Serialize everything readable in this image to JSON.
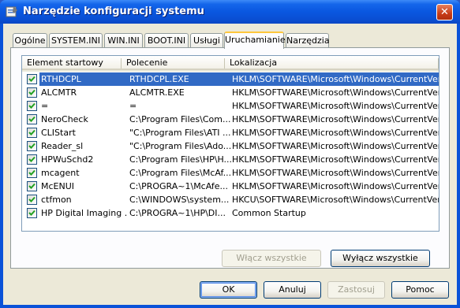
{
  "window": {
    "title": "Narzędzie konfiguracji systemu",
    "close_label": "✕"
  },
  "tabs": [
    {
      "label": "Ogólne"
    },
    {
      "label": "SYSTEM.INI"
    },
    {
      "label": "WIN.INI"
    },
    {
      "label": "BOOT.INI"
    },
    {
      "label": "Usługi"
    },
    {
      "label": "Uruchamianie"
    },
    {
      "label": "Narzędzia"
    }
  ],
  "active_tab": "Uruchamianie",
  "list": {
    "columns": [
      "Element startowy",
      "Polecenie",
      "Lokalizacja"
    ],
    "rows": [
      {
        "checked": true,
        "selected": true,
        "name": "RTHDCPL",
        "command": "RTHDCPL.EXE",
        "location": "HKLM\\SOFTWARE\\Microsoft\\Windows\\CurrentVer..."
      },
      {
        "checked": true,
        "name": "ALCMTR",
        "command": "ALCMTR.EXE",
        "location": "HKLM\\SOFTWARE\\Microsoft\\Windows\\CurrentVer..."
      },
      {
        "checked": true,
        "name": "=",
        "command": "=",
        "location": "HKLM\\SOFTWARE\\Microsoft\\Windows\\CurrentVer..."
      },
      {
        "checked": true,
        "name": "NeroCheck",
        "command": "C:\\Program Files\\Com...",
        "location": "HKLM\\SOFTWARE\\Microsoft\\Windows\\CurrentVer..."
      },
      {
        "checked": true,
        "name": "CLIStart",
        "command": "\"C:\\Program Files\\ATI ...",
        "location": "HKLM\\SOFTWARE\\Microsoft\\Windows\\CurrentVer..."
      },
      {
        "checked": true,
        "name": "Reader_sl",
        "command": "\"C:\\Program Files\\Ado...",
        "location": "HKLM\\SOFTWARE\\Microsoft\\Windows\\CurrentVer..."
      },
      {
        "checked": true,
        "name": "HPWuSchd2",
        "command": "C:\\Program Files\\HP\\H...",
        "location": "HKLM\\SOFTWARE\\Microsoft\\Windows\\CurrentVer..."
      },
      {
        "checked": true,
        "name": "mcagent",
        "command": "C:\\Program Files\\McAf...",
        "location": "HKLM\\SOFTWARE\\Microsoft\\Windows\\CurrentVer..."
      },
      {
        "checked": true,
        "name": "McENUI",
        "command": "C:\\PROGRA~1\\McAfe...",
        "location": "HKLM\\SOFTWARE\\Microsoft\\Windows\\CurrentVer..."
      },
      {
        "checked": true,
        "name": "ctfmon",
        "command": "C:\\WINDOWS\\system...",
        "location": "HKCU\\SOFTWARE\\Microsoft\\Windows\\CurrentVer..."
      },
      {
        "checked": true,
        "name": "HP Digital Imaging ...",
        "command": "C:\\PROGRA~1\\HP\\DI...",
        "location": "Common Startup"
      }
    ]
  },
  "panel_buttons": {
    "enable_all": "Włącz wszystkie",
    "disable_all": "Wyłącz wszystkie"
  },
  "dialog_buttons": {
    "ok": "OK",
    "cancel": "Anuluj",
    "apply": "Zastosuj",
    "help": "Pomoc"
  },
  "colors": {
    "titlebar": "#0a57e0",
    "selection": "#316ac5",
    "active_tab_accent": "#ffc73c",
    "dialog_bg": "#ece9d8"
  }
}
